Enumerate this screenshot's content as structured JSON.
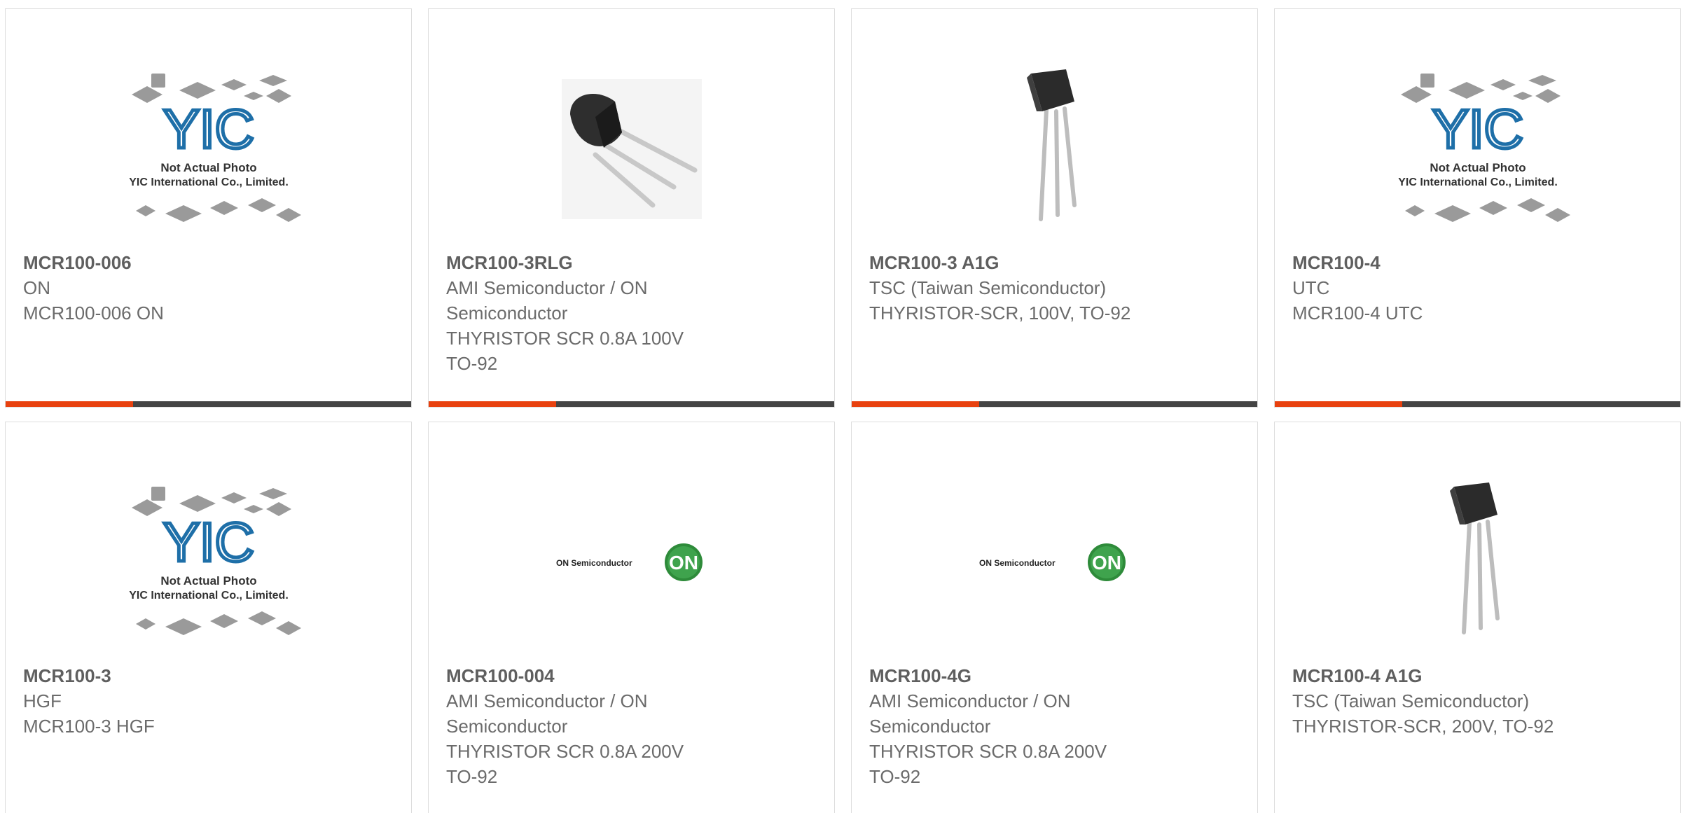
{
  "accent_color": "#e8410f",
  "bar_color": "#444444",
  "placeholder": {
    "brand": "YIC",
    "line1": "Not Actual Photo",
    "line2": "YIC International Co., Limited."
  },
  "on_logo": {
    "text": "ON Semiconductor",
    "mark": "ON"
  },
  "products": [
    {
      "part": "MCR100-006",
      "manufacturer": "ON",
      "desc1": "MCR100-006 ON",
      "desc2": "",
      "image": "yic-placeholder"
    },
    {
      "part": "MCR100-3RLG",
      "manufacturer": "AMI Semiconductor / ON",
      "manufacturer2": "Semiconductor",
      "desc1": "THYRISTOR SCR 0.8A 100V",
      "desc2": "TO-92",
      "image": "to92-horizontal"
    },
    {
      "part": "MCR100-3 A1G",
      "manufacturer": "TSC (Taiwan Semiconductor)",
      "desc1": "THYRISTOR-SCR, 100V, TO-92",
      "desc2": "",
      "image": "to92-vertical"
    },
    {
      "part": "MCR100-4",
      "manufacturer": "UTC",
      "desc1": "MCR100-4 UTC",
      "desc2": "",
      "image": "yic-placeholder"
    },
    {
      "part": "MCR100-3",
      "manufacturer": "HGF",
      "desc1": "MCR100-3 HGF",
      "desc2": "",
      "image": "yic-placeholder"
    },
    {
      "part": "MCR100-004",
      "manufacturer": "AMI Semiconductor / ON",
      "manufacturer2": "Semiconductor",
      "desc1": "THYRISTOR SCR 0.8A 200V",
      "desc2": "TO-92",
      "image": "on-logo"
    },
    {
      "part": "MCR100-4G",
      "manufacturer": "AMI Semiconductor / ON",
      "manufacturer2": "Semiconductor",
      "desc1": "THYRISTOR SCR 0.8A 200V",
      "desc2": "TO-92",
      "image": "on-logo"
    },
    {
      "part": "MCR100-4 A1G",
      "manufacturer": "TSC (Taiwan Semiconductor)",
      "desc1": "THYRISTOR-SCR, 200V, TO-92",
      "desc2": "",
      "image": "to92-vertical"
    }
  ]
}
